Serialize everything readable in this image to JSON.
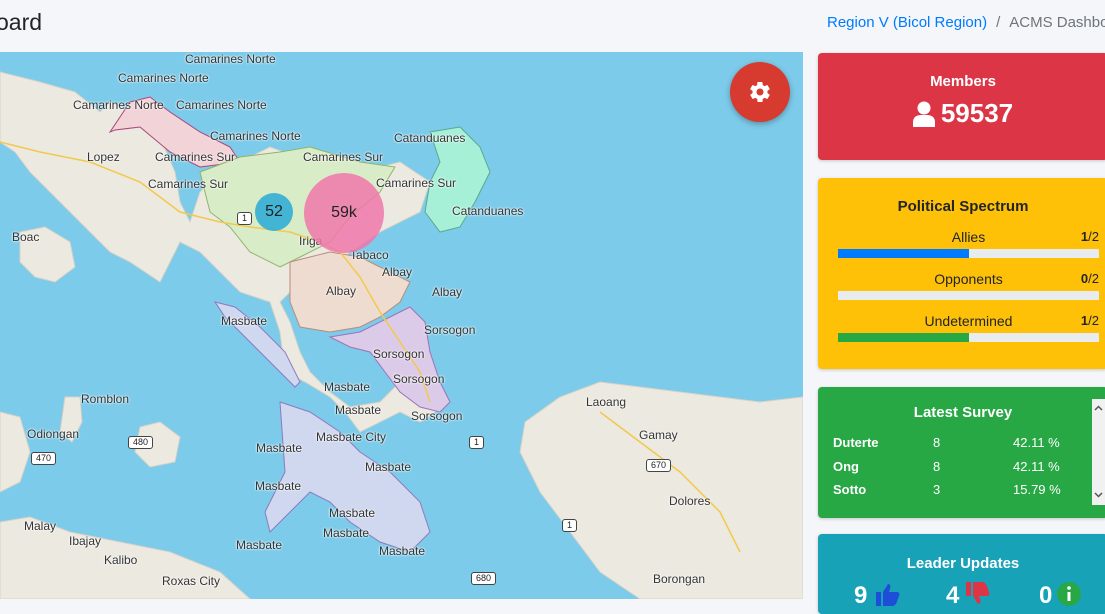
{
  "header": {
    "title": "oard",
    "breadcrumb": {
      "region": "Region V (Bicol Region)",
      "separator": "/",
      "current": "ACMS Dashboa"
    }
  },
  "map": {
    "labels": {
      "camarines_norte_1": "Camarines Norte",
      "camarines_norte_2": "Camarines Norte",
      "camarines_norte_3": "Camarines Norte",
      "camarines_norte_4": "Camarines Norte",
      "camarines_norte_5": "Camarines Norte",
      "camarines_sur_1": "Camarines Sur",
      "camarines_sur_2": "Camarines Sur",
      "camarines_sur_3": "Camarines Sur",
      "camarines_sur_4": "Camarines Sur",
      "catanduanes_1": "Catanduanes",
      "catanduanes_2": "Catanduanes",
      "lopez": "Lopez",
      "boac": "Boac",
      "iriga": "Iriga",
      "tabaco": "Tabaco",
      "albay_1": "Albay",
      "albay_2": "Albay",
      "albay_3": "Albay",
      "masbate_1": "Masbate",
      "masbate_2": "Masbate",
      "masbate_3": "Masbate",
      "masbate_city": "Masbate City",
      "masbate_4": "Masbate",
      "masbate_5": "Masbate",
      "masbate_6": "Masbate",
      "masbate_7": "Masbate",
      "masbate_8": "Masbate",
      "masbate_9": "Masbate",
      "masbate_10": "Masbate",
      "sorsogon_1": "Sorsogon",
      "sorsogon_2": "Sorsogon",
      "sorsogon_3": "Sorsogon",
      "sorsogon_4": "Sorsogon",
      "romblon": "Romblon",
      "odiongan": "Odiongan",
      "laoang": "Laoang",
      "gamay": "Gamay",
      "dolores": "Dolores",
      "borongan": "Borongan",
      "malay": "Malay",
      "ibajay": "Ibajay",
      "kalibo": "Kalibo",
      "roxas_city": "Roxas City"
    },
    "shields": {
      "s1a": "1",
      "s1b": "1",
      "s1c": "1",
      "s480": "480",
      "s470": "470",
      "s670": "670",
      "s680": "680"
    },
    "clusters": {
      "small": "52",
      "big": "59k"
    }
  },
  "cards": {
    "members": {
      "title": "Members",
      "value": "59537"
    },
    "spectrum": {
      "title": "Political Spectrum",
      "rows": [
        {
          "label": "Allies",
          "count": "1",
          "total": "/2",
          "fraction": 0.5,
          "color": "#007bff"
        },
        {
          "label": "Opponents",
          "count": "0",
          "total": "/2",
          "fraction": 0,
          "color": "#6c757d"
        },
        {
          "label": "Undetermined",
          "count": "1",
          "total": "/2",
          "fraction": 0.5,
          "color": "#28a745"
        }
      ]
    },
    "survey": {
      "title": "Latest Survey",
      "rows": [
        {
          "name": "Duterte",
          "votes": "8",
          "pct": "42.11 %"
        },
        {
          "name": "Ong",
          "votes": "8",
          "pct": "42.11 %"
        },
        {
          "name": "Sotto",
          "votes": "3",
          "pct": "15.79 %"
        }
      ]
    },
    "leader": {
      "title": "Leader Updates",
      "up": "9",
      "down": "4",
      "info": "0"
    }
  },
  "colors": {
    "members": "#dc3545",
    "spectrum": "#ffc107",
    "survey": "#28a745",
    "leader": "#17a2b8",
    "gear_button": "#d73a2f"
  },
  "icons": {
    "gear": "gear-icon",
    "user": "user-icon",
    "thumbs_up": "thumbs-up-icon",
    "thumbs_down": "thumbs-down-icon",
    "info": "info-icon"
  }
}
